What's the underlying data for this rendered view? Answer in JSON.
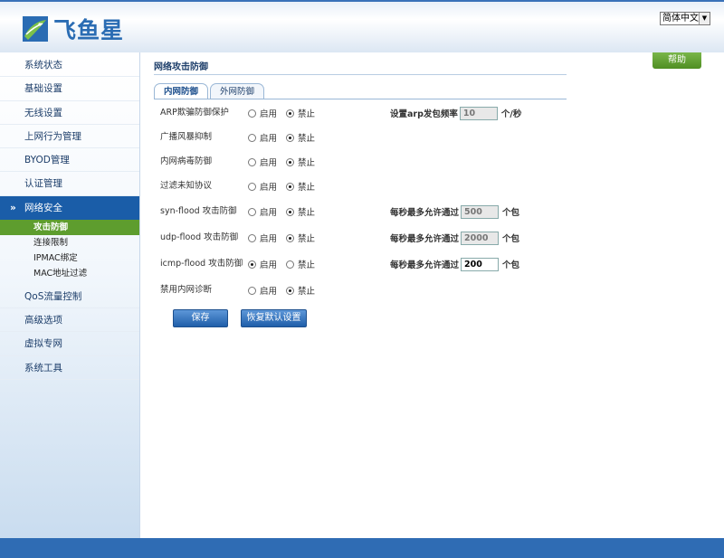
{
  "header": {
    "logo_text": "飞鱼星",
    "language": "简体中文",
    "language_arrow": "▼"
  },
  "sidebar": {
    "items_top": [
      "系统状态",
      "基础设置",
      "无线设置",
      "上网行为管理",
      "BYOD管理",
      "认证管理"
    ],
    "active_group": "网络安全",
    "chevron": "»",
    "sub_items": [
      "攻击防御",
      "连接限制",
      "IPMAC绑定",
      "MAC地址过滤"
    ],
    "items_bottom": [
      "QoS流量控制",
      "高级选项",
      "虚拟专网",
      "系统工具"
    ]
  },
  "main": {
    "help": "帮助",
    "title": "网络攻击防御",
    "tabs": [
      "内网防御",
      "外网防御"
    ],
    "enable_label": "启用",
    "disable_label": "禁止",
    "rows": [
      {
        "label": "ARP欺骗防御保护",
        "enabled": false
      },
      {
        "label": "广播风暴抑制",
        "enabled": false
      },
      {
        "label": "内网病毒防御",
        "enabled": false
      },
      {
        "label": "过滤未知协议",
        "enabled": false
      },
      {
        "label": "syn-flood 攻击防御",
        "enabled": false
      },
      {
        "label": "udp-flood 攻击防御",
        "enabled": false
      },
      {
        "label": "icmp-flood 攻击防御",
        "enabled": true
      },
      {
        "label": "禁用内网诊断",
        "enabled": false
      }
    ],
    "arp_rate": {
      "label": "设置arp发包频率",
      "value": "10",
      "unit": "个/秒"
    },
    "syn_limit": {
      "label": "每秒最多允许通过",
      "value": "500",
      "unit": "个包"
    },
    "udp_limit": {
      "label": "每秒最多允许通过",
      "value": "2000",
      "unit": "个包"
    },
    "icmp_limit": {
      "label": "每秒最多允许通过",
      "value": "200",
      "unit": "个包"
    },
    "save_button": "保存",
    "restore_button": "恢复默认设置"
  }
}
